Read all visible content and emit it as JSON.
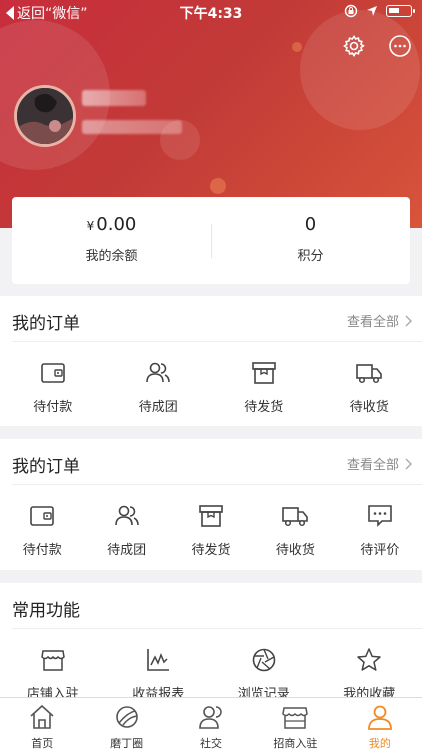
{
  "status_bar": {
    "back_label": "返回“微信”",
    "time": "下午4:33"
  },
  "header": {
    "settings_icon": "gear-icon",
    "message_icon": "chat-bubble-icon"
  },
  "balance_card": {
    "balance_currency": "¥",
    "balance_value": "0.00",
    "balance_label": "我的余额",
    "points_value": "0",
    "points_label": "积分"
  },
  "orders_section_1": {
    "title": "我的订单",
    "more_label": "查看全部",
    "items": [
      {
        "label": "待付款",
        "icon": "wallet-icon"
      },
      {
        "label": "待成团",
        "icon": "group-icon"
      },
      {
        "label": "待发货",
        "icon": "box-icon"
      },
      {
        "label": "待收货",
        "icon": "truck-icon"
      }
    ]
  },
  "orders_section_2": {
    "title": "我的订单",
    "more_label": "查看全部",
    "items": [
      {
        "label": "待付款",
        "icon": "wallet-icon"
      },
      {
        "label": "待成团",
        "icon": "group-icon"
      },
      {
        "label": "待发货",
        "icon": "box-icon"
      },
      {
        "label": "待收货",
        "icon": "truck-icon"
      },
      {
        "label": "待评价",
        "icon": "comment-icon"
      }
    ]
  },
  "functions_section": {
    "title": "常用功能",
    "items": [
      {
        "label": "店铺入驻",
        "icon": "store-icon"
      },
      {
        "label": "收益报表",
        "icon": "chart-icon"
      },
      {
        "label": "浏览记录",
        "icon": "aperture-icon"
      },
      {
        "label": "我的收藏",
        "icon": "star-icon"
      }
    ]
  },
  "tab_bar": {
    "active_color": "#f08a24",
    "items": [
      {
        "label": "首页",
        "icon": "home-icon"
      },
      {
        "label": "磨丁圈",
        "icon": "planet-icon"
      },
      {
        "label": "社交",
        "icon": "users-icon"
      },
      {
        "label": "招商入驻",
        "icon": "shop-icon"
      },
      {
        "label": "我的",
        "icon": "profile-icon"
      }
    ]
  }
}
